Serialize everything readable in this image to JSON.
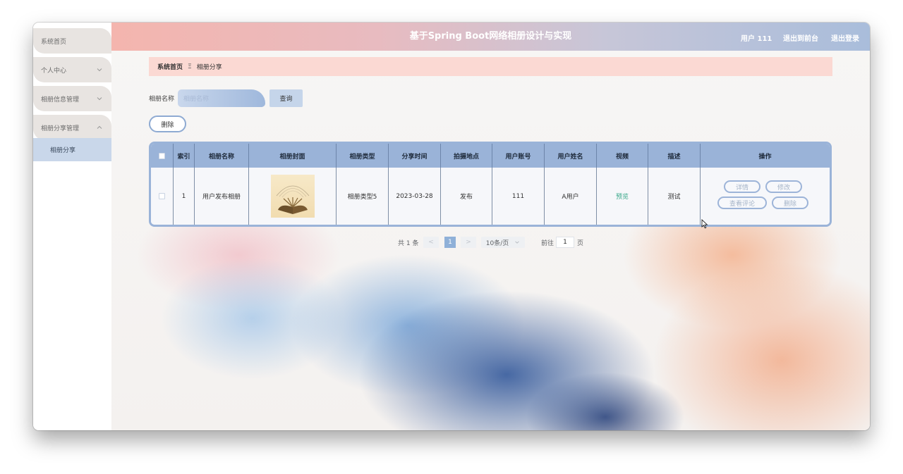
{
  "app": {
    "title": "基于Spring Boot网络相册设计与实现",
    "user_label": "用户 111",
    "back_to_admin": "退出到前台",
    "logout": "退出登录"
  },
  "sidebar": {
    "items": [
      {
        "label": "系统首页"
      },
      {
        "label": "个人中心"
      },
      {
        "label": "相册信息管理"
      },
      {
        "label": "相册分享管理"
      }
    ],
    "sub_item": "相册分享"
  },
  "breadcrumb": {
    "home": "系统首页",
    "separator": "Ξ",
    "current": "相册分享"
  },
  "search": {
    "label": "相册名称",
    "placeholder": "相册名称",
    "button": "查询"
  },
  "actions": {
    "delete": "删除"
  },
  "table": {
    "headers": [
      "索引",
      "相册名称",
      "相册封面",
      "相册类型",
      "分享时间",
      "拍摄地点",
      "用户账号",
      "用户姓名",
      "视频",
      "描述",
      "操作"
    ],
    "rows": [
      {
        "index": "1",
        "album_name": "用户发布相册",
        "album_type": "相册类型5",
        "share_time": "2023-03-28",
        "location": "发布",
        "account": "111",
        "user_name": "A用户",
        "video": "预览",
        "description": "测试",
        "ops": {
          "detail": "详情",
          "edit": "修改",
          "comments": "查看评论",
          "delete": "删除"
        }
      }
    ]
  },
  "pagination": {
    "total": "共 1 条",
    "prev": "<",
    "current_page": "1",
    "next": ">",
    "page_size": "10条/页",
    "goto_label": "前往",
    "goto_value": "1",
    "goto_unit": "页"
  },
  "colors": {
    "accent": "#9ab3d8",
    "preview_link": "#3aa88a",
    "breadcrumb_bg": "#fbd9d3"
  }
}
